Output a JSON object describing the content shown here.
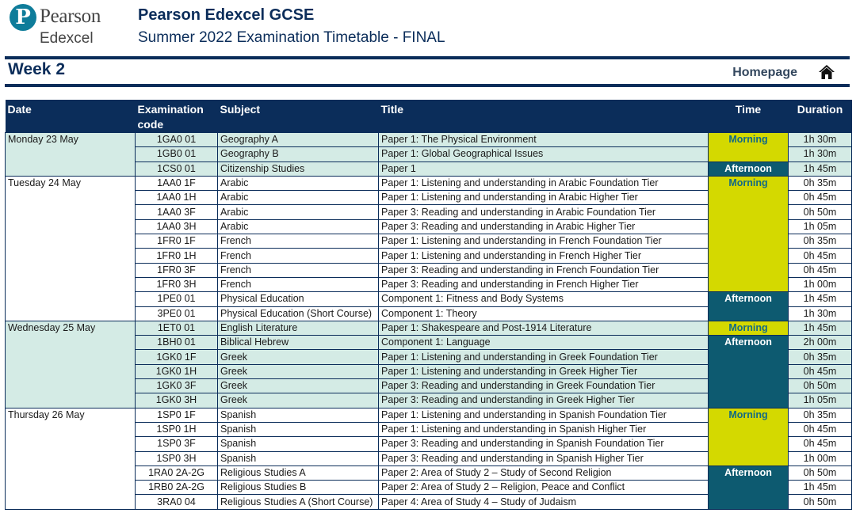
{
  "header": {
    "logo_mark": "P",
    "logo_line1": "Pearson",
    "logo_line2": "Edexcel",
    "title": "Pearson Edexcel GCSE",
    "subtitle": "Summer 2022 Examination Timetable - FINAL"
  },
  "week_bar": {
    "title": "Week 2",
    "homepage_label": "Homepage",
    "home_icon": "home-icon"
  },
  "colors": {
    "navy": "#0b2d5a",
    "shade_row": "#d4ebe5",
    "morning": "#d4d900",
    "afternoon": "#0d5a70",
    "logo_teal": "#0e7c9a"
  },
  "table": {
    "columns": [
      "Date",
      "Examination code",
      "Subject",
      "Title",
      "Time",
      "Duration"
    ],
    "days": [
      {
        "date": "Monday 23 May",
        "shaded": true,
        "sessions": [
          {
            "time": "Morning",
            "rows": [
              {
                "code": "1GA0 01",
                "subject": "Geography A",
                "title": "Paper 1: The Physical Environment",
                "duration": "1h 30m"
              },
              {
                "code": "1GB0 01",
                "subject": "Geography B",
                "title": "Paper 1: Global Geographical Issues",
                "duration": "1h 30m"
              }
            ]
          },
          {
            "time": "Afternoon",
            "rows": [
              {
                "code": "1CS0 01",
                "subject": "Citizenship Studies",
                "title": "Paper 1",
                "duration": "1h 45m"
              }
            ]
          }
        ]
      },
      {
        "date": "Tuesday 24 May",
        "shaded": false,
        "sessions": [
          {
            "time": "Morning",
            "rows": [
              {
                "code": "1AA0 1F",
                "subject": "Arabic",
                "title": "Paper 1: Listening and understanding in Arabic Foundation Tier",
                "duration": "0h 35m"
              },
              {
                "code": "1AA0 1H",
                "subject": "Arabic",
                "title": "Paper 1: Listening and understanding in Arabic Higher Tier",
                "duration": "0h 45m"
              },
              {
                "code": "1AA0 3F",
                "subject": "Arabic",
                "title": "Paper 3: Reading and understanding in Arabic Foundation Tier",
                "duration": "0h 50m"
              },
              {
                "code": "1AA0 3H",
                "subject": "Arabic",
                "title": "Paper 3: Reading and understanding in Arabic Higher Tier",
                "duration": "1h 05m"
              },
              {
                "code": "1FR0 1F",
                "subject": "French",
                "title": "Paper 1: Listening and understanding in French Foundation Tier",
                "duration": "0h 35m"
              },
              {
                "code": "1FR0 1H",
                "subject": "French",
                "title": "Paper 1: Listening and understanding in French Higher Tier",
                "duration": "0h 45m"
              },
              {
                "code": "1FR0 3F",
                "subject": "French",
                "title": "Paper 3: Reading and understanding in French Foundation Tier",
                "duration": "0h 45m"
              },
              {
                "code": "1FR0 3H",
                "subject": "French",
                "title": "Paper 3: Reading and understanding in French Higher Tier",
                "duration": "1h 00m"
              }
            ]
          },
          {
            "time": "Afternoon",
            "rows": [
              {
                "code": "1PE0 01",
                "subject": "Physical Education",
                "title": "Component 1: Fitness and Body Systems",
                "duration": "1h 45m"
              },
              {
                "code": "3PE0 01",
                "subject": "Physical Education (Short Course)",
                "title": "Component 1: Theory",
                "duration": "1h 30m"
              }
            ]
          }
        ]
      },
      {
        "date": "Wednesday 25 May",
        "shaded": true,
        "sessions": [
          {
            "time": "Morning",
            "rows": [
              {
                "code": "1ET0 01",
                "subject": "English Literature",
                "title": "Paper 1: Shakespeare and Post-1914 Literature",
                "duration": "1h 45m"
              }
            ]
          },
          {
            "time": "Afternoon",
            "rows": [
              {
                "code": "1BH0 01",
                "subject": "Biblical Hebrew",
                "title": "Component 1: Language",
                "duration": "2h 00m"
              },
              {
                "code": "1GK0 1F",
                "subject": "Greek",
                "title": "Paper 1: Listening and understanding in Greek Foundation Tier",
                "duration": "0h 35m"
              },
              {
                "code": "1GK0 1H",
                "subject": "Greek",
                "title": "Paper 1: Listening and understanding in Greek Higher Tier",
                "duration": "0h 45m"
              },
              {
                "code": "1GK0 3F",
                "subject": "Greek",
                "title": "Paper 3: Reading and understanding in Greek Foundation Tier",
                "duration": "0h 50m"
              },
              {
                "code": "1GK0 3H",
                "subject": "Greek",
                "title": "Paper 3: Reading and understanding in Greek Higher Tier",
                "duration": "1h 05m"
              }
            ]
          }
        ]
      },
      {
        "date": "Thursday 26 May",
        "shaded": false,
        "sessions": [
          {
            "time": "Morning",
            "rows": [
              {
                "code": "1SP0 1F",
                "subject": "Spanish",
                "title": "Paper 1: Listening and understanding in Spanish Foundation Tier",
                "duration": "0h 35m"
              },
              {
                "code": "1SP0 1H",
                "subject": "Spanish",
                "title": "Paper 1: Listening and understanding in Spanish Higher Tier",
                "duration": "0h 45m"
              },
              {
                "code": "1SP0 3F",
                "subject": "Spanish",
                "title": "Paper 3: Reading and understanding in Spanish Foundation Tier",
                "duration": "0h 45m"
              },
              {
                "code": "1SP0 3H",
                "subject": "Spanish",
                "title": "Paper 3: Reading and understanding in Spanish Higher Tier",
                "duration": "1h 00m"
              }
            ]
          },
          {
            "time": "Afternoon",
            "rows": [
              {
                "code": "1RA0 2A-2G",
                "subject": "Religious Studies A",
                "title": "Paper 2: Area of Study 2 – Study of Second Religion",
                "duration": "0h 50m"
              },
              {
                "code": "1RB0 2A-2G",
                "subject": "Religious Studies B",
                "title": "Paper 2: Area of Study 2 – Religion, Peace and Conflict",
                "duration": "1h 45m"
              },
              {
                "code": "3RA0 04",
                "subject": "Religious Studies A (Short Course)",
                "title": "Paper 4: Area of Study 4 – Study of Judaism",
                "duration": "0h 50m"
              }
            ]
          }
        ]
      }
    ]
  }
}
